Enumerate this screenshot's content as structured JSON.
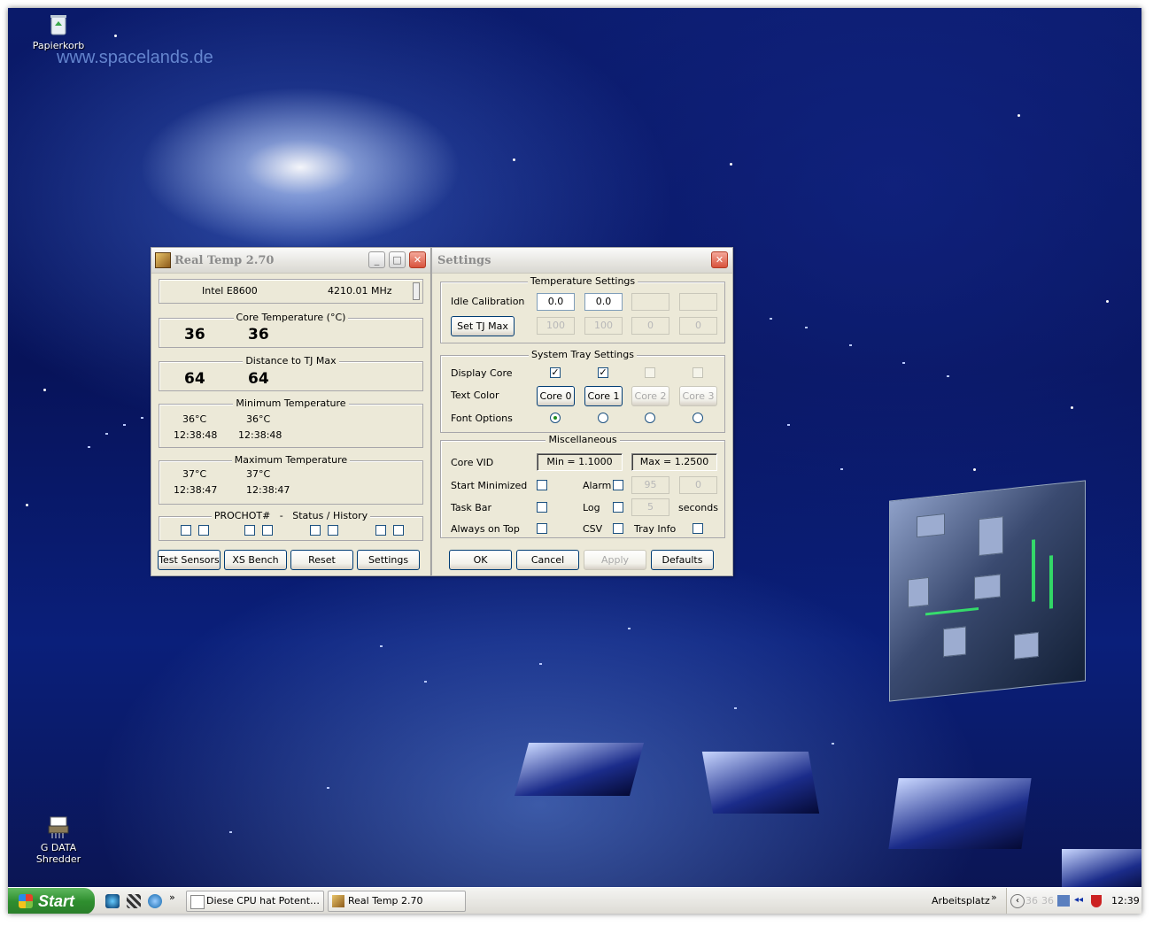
{
  "desktop": {
    "watermark": "www.spacelands.de",
    "icons": [
      {
        "label": "Papierkorb",
        "icon": "recycle-bin-icon"
      },
      {
        "label": "G DATA Shredder",
        "icon": "shredder-icon"
      }
    ]
  },
  "realtemp": {
    "title": "Real Temp 2.70",
    "cpu_model": "Intel E8600",
    "cpu_clock": "4210.01 MHz",
    "core_temp_label": "Core Temperature (°C)",
    "core_temp": [
      "36",
      "36"
    ],
    "distance_label": "Distance to TJ Max",
    "distance": [
      "64",
      "64"
    ],
    "min_label": "Minimum Temperature",
    "min_values": [
      {
        "temp": "36°C",
        "time": "12:38:48"
      },
      {
        "temp": "36°C",
        "time": "12:38:48"
      }
    ],
    "max_label": "Maximum Temperature",
    "max_values": [
      {
        "temp": "37°C",
        "time": "12:38:47"
      },
      {
        "temp": "37°C",
        "time": "12:38:47"
      }
    ],
    "prochot_label": "PROCHOT#   -   Status / History",
    "buttons": [
      "Test Sensors",
      "XS Bench",
      "Reset",
      "Settings"
    ]
  },
  "settings": {
    "title": "Settings",
    "temp_group": "Temperature Settings",
    "idle_calibration_label": "Idle Calibration",
    "idle_calibration": [
      "0.0",
      "0.0",
      "",
      ""
    ],
    "set_tj_max_label": "Set TJ Max",
    "tj_max": [
      "100",
      "100",
      "0",
      "0"
    ],
    "tray_group": "System Tray Settings",
    "display_core_label": "Display Core",
    "display_core_checked": [
      true,
      true,
      false,
      false
    ],
    "text_color_label": "Text Color",
    "core_buttons": [
      "Core 0",
      "Core 1",
      "Core 2",
      "Core 3"
    ],
    "font_options_label": "Font Options",
    "font_option_selected": 0,
    "misc_group": "Miscellaneous",
    "core_vid_label": "Core VID",
    "vid_min": "Min = 1.1000",
    "vid_max": "Max = 1.2500",
    "start_minimized_label": "Start Minimized",
    "alarm_label": "Alarm",
    "alarm_values": [
      "95",
      "0"
    ],
    "task_bar_label": "Task Bar",
    "log_label": "Log",
    "log_interval": "5",
    "seconds_label": "seconds",
    "always_on_top_label": "Always on Top",
    "csv_label": "CSV",
    "tray_info_label": "Tray Info",
    "buttons": [
      "OK",
      "Cancel",
      "Apply",
      "Defaults"
    ]
  },
  "taskbar": {
    "start_label": "Start",
    "tasks": [
      "Diese CPU hat Potent…",
      "Real Temp 2.70"
    ],
    "address_label": "Arbeitsplatz",
    "tray_temps": [
      "36",
      "36"
    ],
    "clock": "12:39"
  }
}
